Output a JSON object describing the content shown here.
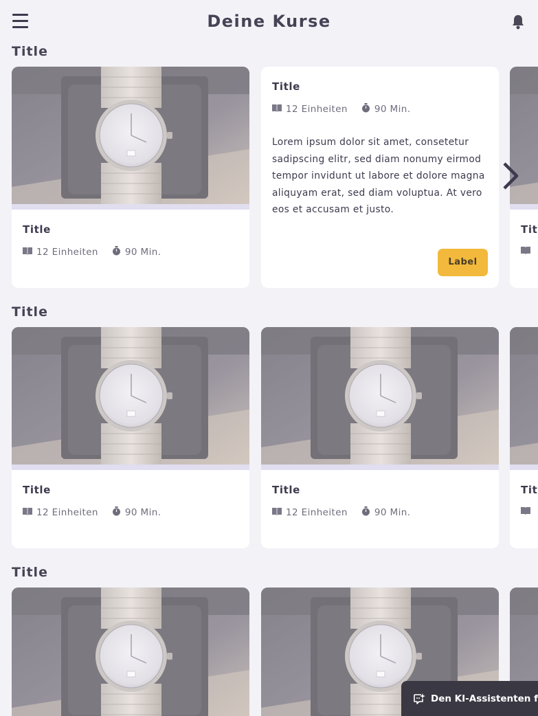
{
  "header": {
    "title": "Deine Kurse",
    "menu_icon": "hamburger-menu-icon",
    "notification_icon": "bell-icon"
  },
  "sections": [
    {
      "title": "Title",
      "cards": [
        {
          "title": "Title",
          "units": "12 Einheiten",
          "duration": "90 Min."
        },
        {
          "title": "Title",
          "units": "12 Einheiten",
          "duration": "90 Min.",
          "description": "Lorem ipsum dolor sit amet, consetetur sadipscing elitr, sed diam nonumy eirmod tempor invidunt ut labore et dolore magna aliquyam erat, sed diam voluptua. At vero eos et accusam et justo.",
          "button": "Label"
        },
        {
          "title": "Title"
        }
      ]
    },
    {
      "title": "Title",
      "cards": [
        {
          "title": "Title",
          "units": "12 Einheiten",
          "duration": "90 Min."
        },
        {
          "title": "Title",
          "units": "12 Einheiten",
          "duration": "90 Min."
        },
        {
          "title": "Title"
        }
      ]
    },
    {
      "title": "Title"
    }
  ],
  "assistant_button": {
    "label": "Den KI-Assistenten fra",
    "icon": "ai-chat-icon"
  },
  "colors": {
    "background": "#f3f2f7",
    "accent": "#f2b93c",
    "text": "#3d3a4d"
  }
}
